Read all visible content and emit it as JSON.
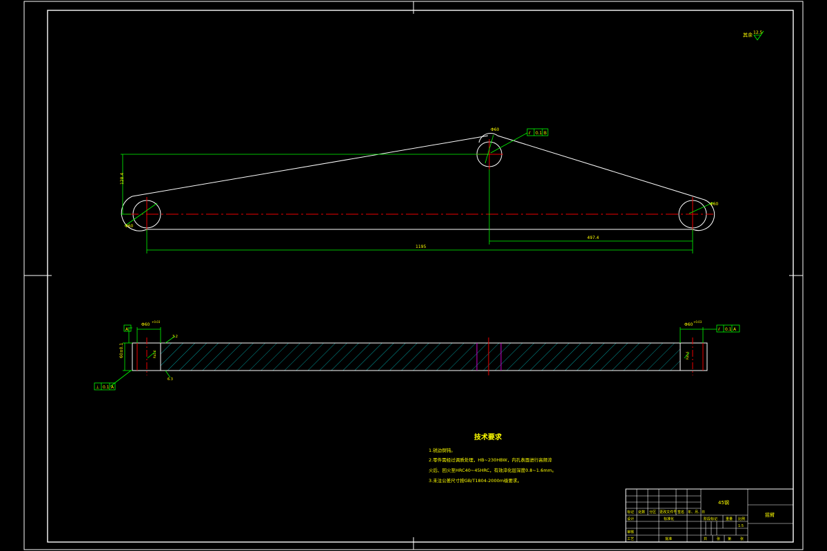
{
  "drawing": {
    "surface_note": "其余",
    "surface_value": "12.5",
    "top_view": {
      "dim_total": "1195",
      "dim_right": "497.4",
      "dim_height": "128.4",
      "dim_top_hole": "Φ60",
      "dim_right_hole": "Φ60",
      "dim_left_hole": "Φ60",
      "tol_frame_top": [
        "⫽",
        "0.1",
        "B"
      ]
    },
    "side_view": {
      "datum_a": "A",
      "datum_box_left": [
        "⊥",
        "0.1",
        "A"
      ],
      "dim_thickness": "60±0.1",
      "dim_hole_left": "Φ60",
      "dim_hole_right": "Φ60",
      "tol_left": "+0.03",
      "tol_right": "+0.03",
      "tol_frame_right": [
        "⫽",
        "0.1",
        "A"
      ],
      "label_roughness_top": "3.2",
      "label_roughness_bottom": "6.3",
      "label_mark_left": "Ra1.6",
      "label_mark_right": "Ra1.6"
    },
    "tech_requirements": {
      "title": "技术要求",
      "lines": [
        "1.锐边倒钝。",
        "2.零件需经过调质处理，HB~230HBW，内孔表面进行高频淬",
        "  火后、回火至HRC40~45HRC，有效淬化层深度0.8~1.6mm。",
        "3.未注公差尺寸按GB/T1804-2000m级要求。"
      ]
    },
    "title_block": {
      "material": "45钢",
      "part_name": "摇臂",
      "scale_label": "比例",
      "scale": "1:5",
      "row_labels": [
        "标记",
        "处数",
        "分区",
        "更改文件号",
        "签名",
        "年、月、日"
      ],
      "design": "设计",
      "check": "审核",
      "process": "工艺",
      "standard": "标准化",
      "approve": "批准",
      "stage_label": "阶段标记",
      "weight_label": "重量",
      "sheet_labels": [
        "共",
        "张",
        "第",
        "张"
      ]
    }
  }
}
